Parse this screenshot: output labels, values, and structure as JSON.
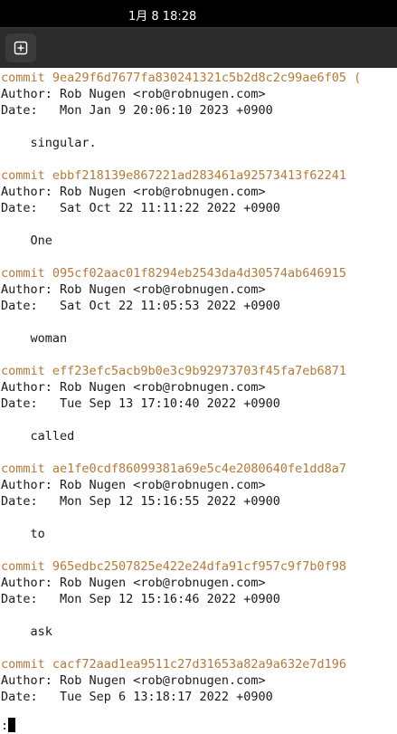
{
  "status_bar": {
    "clock": "1月 8  18:28"
  },
  "header": {
    "new_tab_icon": "new-tab-icon"
  },
  "terminal": {
    "commits": [
      {
        "commit": "commit 9ea29f6d7677fa830241321c5b2d8c2c99ae6f05 (",
        "author": "Author: Rob Nugen <rob@robnugen.com>",
        "date": "Date:   Mon Jan 9 20:06:10 2023 +0900",
        "message": "    singular."
      },
      {
        "commit": "commit ebbf218139e867221ad283461a92573413f62241",
        "author": "Author: Rob Nugen <rob@robnugen.com>",
        "date": "Date:   Sat Oct 22 11:11:22 2022 +0900",
        "message": "    One"
      },
      {
        "commit": "commit 095cf02aac01f8294eb2543da4d30574ab646915",
        "author": "Author: Rob Nugen <rob@robnugen.com>",
        "date": "Date:   Sat Oct 22 11:05:53 2022 +0900",
        "message": "    woman"
      },
      {
        "commit": "commit eff23efc5acb9b0e3c9b92973703f45fa7eb6871",
        "author": "Author: Rob Nugen <rob@robnugen.com>",
        "date": "Date:   Tue Sep 13 17:10:40 2022 +0900",
        "message": "    called"
      },
      {
        "commit": "commit ae1fe0cdf86099381a69e5c4e2080640fe1dd8a7",
        "author": "Author: Rob Nugen <rob@robnugen.com>",
        "date": "Date:   Mon Sep 12 15:16:55 2022 +0900",
        "message": "    to"
      },
      {
        "commit": "commit 965edbc2507825e422e24dfa91cf957c9f7b0f98",
        "author": "Author: Rob Nugen <rob@robnugen.com>",
        "date": "Date:   Mon Sep 12 15:16:46 2022 +0900",
        "message": "    ask"
      },
      {
        "commit": "commit cacf72aad1ea9511c27d31653a82a9a632e7d196",
        "author": "Author: Rob Nugen <rob@robnugen.com>",
        "date": "Date:   Tue Sep 6 13:18:17 2022 +0900"
      }
    ],
    "prompt": ":"
  }
}
